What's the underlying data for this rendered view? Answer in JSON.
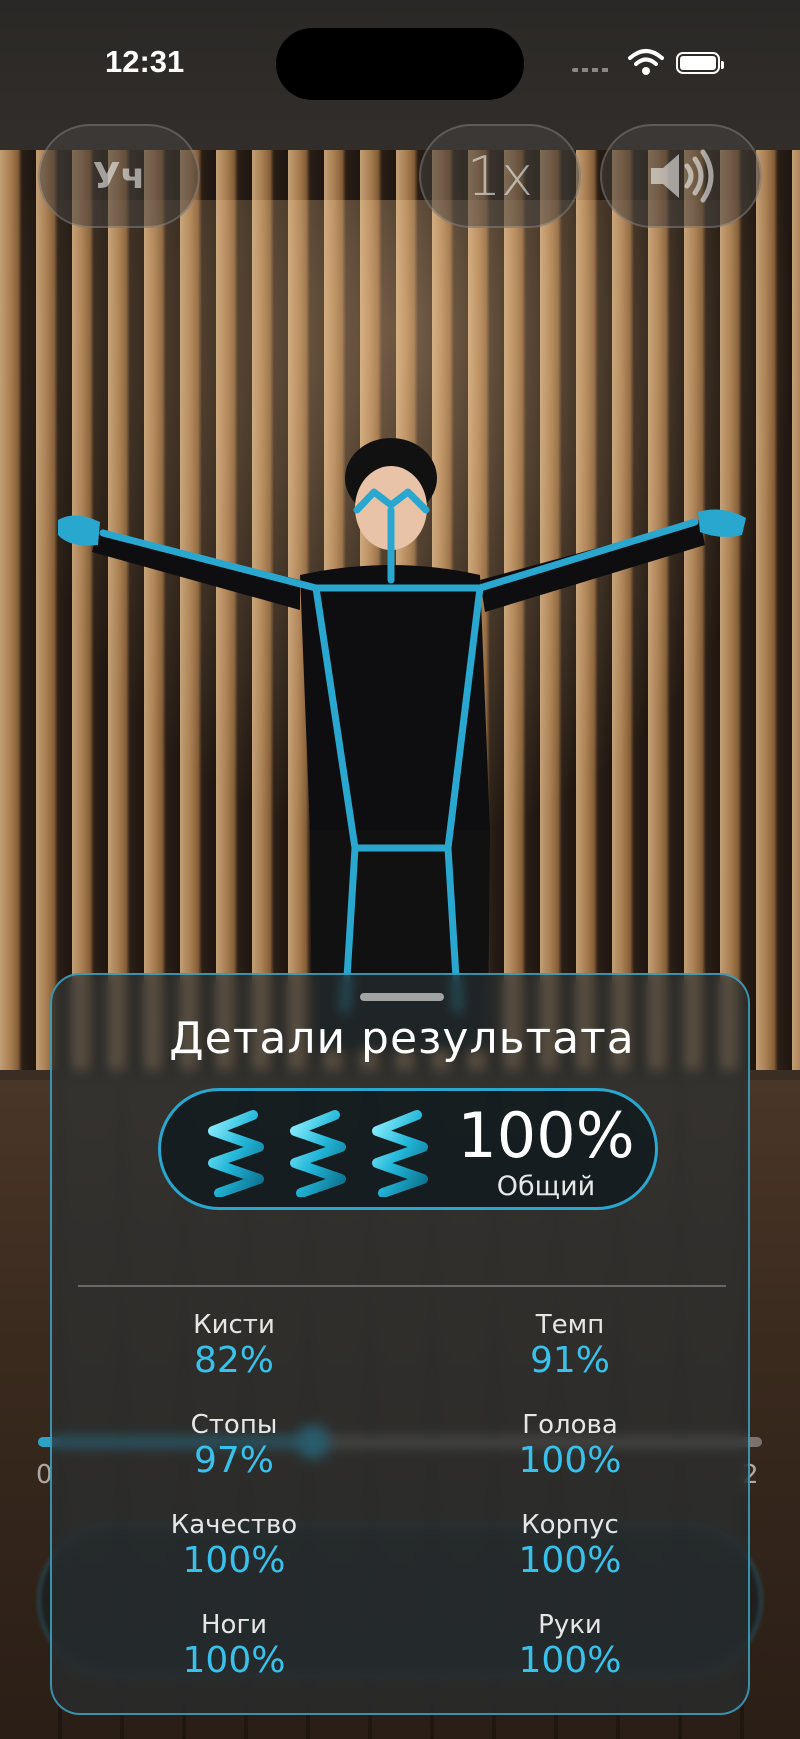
{
  "status_bar": {
    "time": "12:31"
  },
  "top_controls": {
    "learn_label": "Уч",
    "speed_label": "1x",
    "sound_icon": "speaker-wave-icon"
  },
  "player": {
    "progress_fraction": 0.38,
    "time_start": "0",
    "time_end": "2"
  },
  "result_sheet": {
    "title": "Детали результата",
    "overall": {
      "value": "100%",
      "label": "Общий",
      "icon": "spring-icon",
      "icon_count": 3
    },
    "metrics": [
      {
        "label": "Кисти",
        "value": "82%"
      },
      {
        "label": "Темп",
        "value": "91%"
      },
      {
        "label": "Стопы",
        "value": "97%"
      },
      {
        "label": "Голова",
        "value": "100%"
      },
      {
        "label": "Качество",
        "value": "100%"
      },
      {
        "label": "Корпус",
        "value": "100%"
      },
      {
        "label": "Ноги",
        "value": "100%"
      },
      {
        "label": "Руки",
        "value": "100%"
      }
    ]
  },
  "colors": {
    "accent": "#2ba3c9",
    "metric_value": "#38c1ea"
  }
}
